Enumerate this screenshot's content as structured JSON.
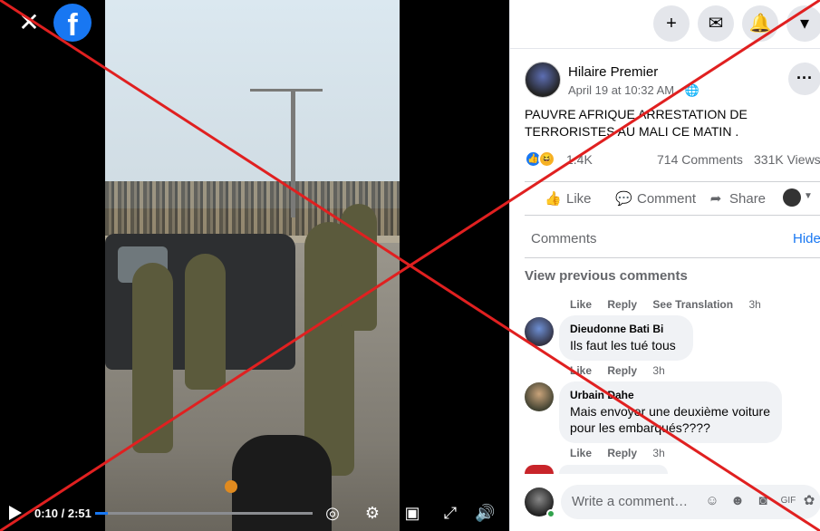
{
  "top_bar": {
    "create_icon": "plus-icon",
    "messenger_icon": "messenger-icon",
    "notifications_icon": "bell-icon",
    "account_icon": "caret-down-icon"
  },
  "video": {
    "time": "0:10 / 2:51",
    "progress_fraction": 0.058
  },
  "post": {
    "author": "Hilaire Premier",
    "meta": "April 19 at 10:32 AM · ",
    "text": "PAUVRE AFRIQUE ARRESTATION DE TERRORISTES AU MALI CE MATIN .",
    "reaction_count": "1.4K",
    "comments_count": "714 Comments",
    "views_count": "331K Views"
  },
  "actions": {
    "like": "Like",
    "comment": "Comment",
    "share": "Share"
  },
  "comments_section": {
    "tab_label": "Comments",
    "hide_label": "Hide",
    "view_previous": "View previous comments",
    "items": [
      {
        "like": "Like",
        "reply": "Reply",
        "see_translation": "See Translation",
        "time": "3h"
      },
      {
        "name": "Dieudonne Bati Bi",
        "text": "Ils faut les tué tous",
        "like": "Like",
        "reply": "Reply",
        "time": "3h"
      },
      {
        "name": "Urbain Dahe",
        "text": "Mais envoyer une deuxième voiture pour les embarqués????",
        "like": "Like",
        "reply": "Reply",
        "time": "3h"
      }
    ],
    "compose_placeholder": "Write a comment…"
  },
  "colors": {
    "brand": "#1877f2",
    "cross": "#e02020",
    "online": "#31a24c"
  }
}
